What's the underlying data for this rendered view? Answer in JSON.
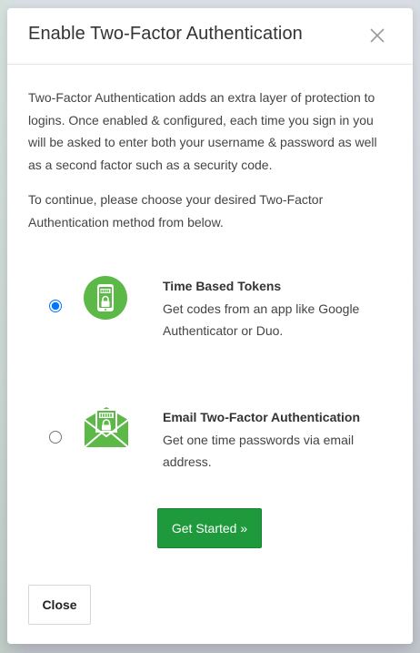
{
  "dialog": {
    "title": "Enable Two-Factor Authentication",
    "close_icon": "close-icon"
  },
  "intro": {
    "paragraph_1": "Two-Factor Authentication adds an extra layer of protection to logins. Once enabled & configured, each time you sign in you will be asked to enter both your username & password as well as a second factor such as a security code.",
    "paragraph_2": "To continue, please choose your desired Two-Factor Authentication method from below."
  },
  "methods": [
    {
      "title": "Time Based Tokens",
      "description": "Get codes from an app like Google Authenticator or Duo.",
      "icon": "phone-lock-icon",
      "selected": true
    },
    {
      "title": "Email Two-Factor Authentication",
      "description": "Get one time passwords via email address.",
      "icon": "envelope-lock-icon",
      "selected": false
    }
  ],
  "actions": {
    "get_started_label": "Get Started »",
    "close_label": "Close"
  },
  "colors": {
    "accent_green": "#1e9a3c",
    "icon_green": "#5cb947",
    "radio_blue": "#2979ff"
  }
}
